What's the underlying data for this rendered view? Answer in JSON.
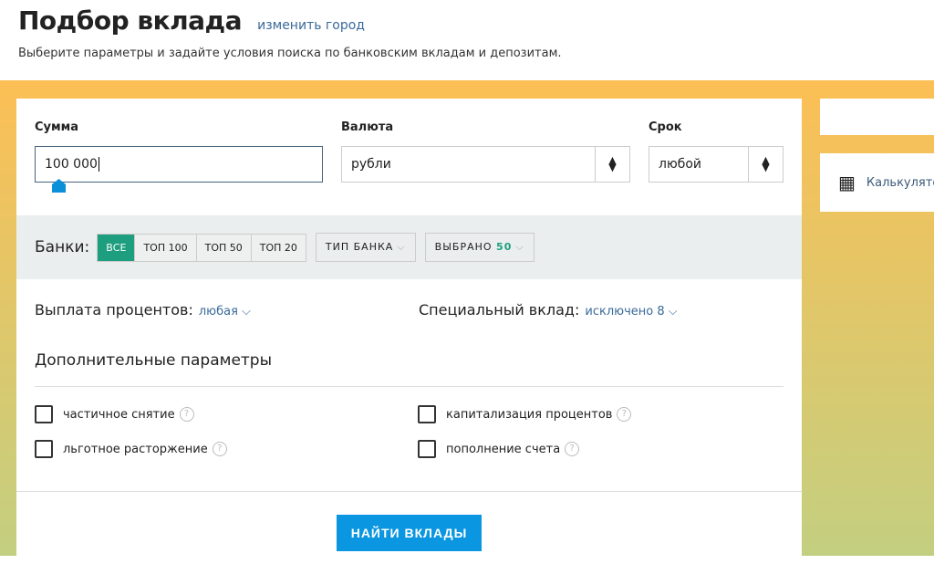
{
  "header": {
    "title": "Подбор вклада",
    "change_city": "изменить город",
    "subtitle": "Выберите параметры и задайте условия поиска по банковским вкладам и депозитам."
  },
  "form": {
    "sum_label": "Сумма",
    "sum_value": "100 000",
    "currency_label": "Валюта",
    "currency_value": "рубли",
    "term_label": "Срок",
    "term_value": "любой"
  },
  "banks": {
    "label": "Банки:",
    "segments": [
      "ВСЕ",
      "ТОП 100",
      "ТОП 50",
      "ТОП 20"
    ],
    "type_label": "ТИП БАНКА",
    "selected_label": "ВЫБРАНО",
    "selected_count": "50",
    "active_color": "#1d9e7f"
  },
  "payout": {
    "label": "Выплата процентов:",
    "value": "любая"
  },
  "special": {
    "label": "Специальный вклад:",
    "value": "исключено 8"
  },
  "extra": {
    "title": "Дополнительные параметры",
    "options": [
      {
        "label": "частичное снятие",
        "checked": false
      },
      {
        "label": "капитализация процентов",
        "checked": false
      },
      {
        "label": "льготное расторжение",
        "checked": false
      },
      {
        "label": "пополнение счета",
        "checked": false
      }
    ]
  },
  "submit_label": "НАЙТИ ВКЛАДЫ",
  "sidebar": {
    "calculator_label": "Калькулятор"
  }
}
